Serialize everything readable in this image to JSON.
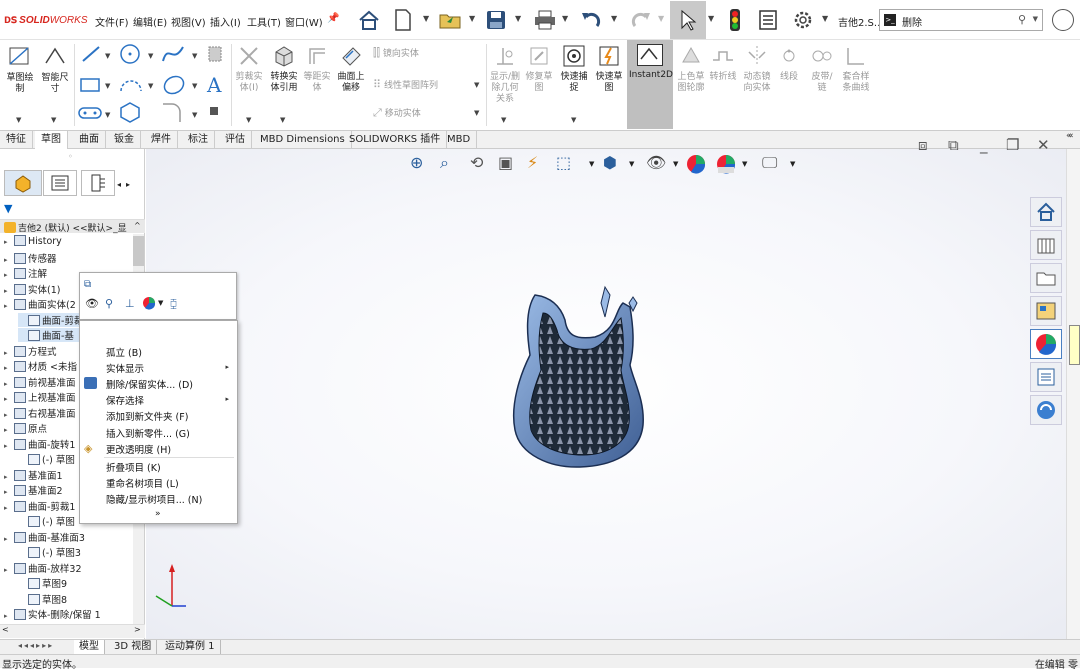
{
  "app": {
    "name_solid": "SOLID",
    "name_works": "WORKS",
    "doc_name": "吉他2.S..."
  },
  "menubar": [
    "文件(F)",
    "编辑(E)",
    "视图(V)",
    "插入(I)",
    "工具(T)",
    "窗口(W)"
  ],
  "search": {
    "value": "删除"
  },
  "ribbon": {
    "buttons": [
      {
        "id": "sketch",
        "label": "草图绘制",
        "disabled": false
      },
      {
        "id": "smartdim",
        "label": "智能尺寸",
        "disabled": false
      },
      {
        "id": "trim",
        "label": "剪裁实体(I)",
        "disabled": true
      },
      {
        "id": "convert",
        "label": "转换实体引用",
        "disabled": false
      },
      {
        "id": "offset",
        "label": "等距实体",
        "disabled": true
      },
      {
        "id": "offsetsurf",
        "label": "曲面上偏移",
        "disabled": false
      },
      {
        "id": "mirror",
        "label": "镜向实体",
        "disabled": true
      },
      {
        "id": "linpattern",
        "label": "线性草图阵列",
        "disabled": true
      },
      {
        "id": "move",
        "label": "移动实体",
        "disabled": true
      },
      {
        "id": "relations",
        "label": "显示/删除几何关系",
        "disabled": true
      },
      {
        "id": "repair",
        "label": "修复草图",
        "disabled": true
      },
      {
        "id": "snap",
        "label": "快速捕捉",
        "disabled": false
      },
      {
        "id": "rapid",
        "label": "快速草图",
        "disabled": false
      },
      {
        "id": "instant2d",
        "label": "Instant2D",
        "disabled": false
      },
      {
        "id": "shaded",
        "label": "上色草图轮廓",
        "disabled": true
      },
      {
        "id": "jog",
        "label": "转折线",
        "disabled": true
      },
      {
        "id": "dynmirror",
        "label": "动态镜向实体",
        "disabled": true
      },
      {
        "id": "segment",
        "label": "线段",
        "disabled": true
      },
      {
        "id": "chain",
        "label": "皮带/链",
        "disabled": true
      },
      {
        "id": "spline",
        "label": "套合样条曲线",
        "disabled": true
      }
    ]
  },
  "tabs": [
    "特征",
    "草图",
    "曲面",
    "钣金",
    "焊件",
    "标注",
    "评估",
    "MBD Dimensions",
    "SOLIDWORKS 插件",
    "MBD"
  ],
  "active_tab": "草图",
  "tree": {
    "root": "吉他2 (默认) <<默认>_显",
    "items": [
      {
        "label": "History",
        "indent": 0
      },
      {
        "label": "传感器",
        "indent": 0
      },
      {
        "label": "注解",
        "indent": 0
      },
      {
        "label": "实体(1)",
        "indent": 0
      },
      {
        "label": "曲面实体(2",
        "indent": 0
      },
      {
        "label": "曲面-剪裁1",
        "indent": 1
      },
      {
        "label": "曲面-基",
        "indent": 1
      },
      {
        "label": "方程式",
        "indent": 0
      },
      {
        "label": "材质 <未指",
        "indent": 0
      },
      {
        "label": "前视基准面",
        "indent": 0
      },
      {
        "label": "上视基准面",
        "indent": 0
      },
      {
        "label": "右视基准面",
        "indent": 0
      },
      {
        "label": "原点",
        "indent": 0
      },
      {
        "label": "曲面-旋转1",
        "indent": 0
      },
      {
        "label": "(-) 草图",
        "indent": 1
      },
      {
        "label": "基准面1",
        "indent": 0
      },
      {
        "label": "基准面2",
        "indent": 0
      },
      {
        "label": "曲面-剪裁1",
        "indent": 0
      },
      {
        "label": "(-) 草图",
        "indent": 1
      },
      {
        "label": "曲面-基准面3",
        "indent": 0
      },
      {
        "label": "(-) 草图3",
        "indent": 1
      },
      {
        "label": "曲面-放样32",
        "indent": 0
      },
      {
        "label": "草图9",
        "indent": 1
      },
      {
        "label": "草图8",
        "indent": 1
      },
      {
        "label": "实体-删除/保留 1",
        "indent": 0
      }
    ]
  },
  "context_menu": {
    "tooltip": "显示",
    "items": [
      {
        "label": "孤立 (B)",
        "submenu": false
      },
      {
        "label": "实体显示",
        "submenu": true
      },
      {
        "label": "删除/保留实体... (D)",
        "submenu": false
      },
      {
        "label": "保存选择",
        "submenu": true
      },
      {
        "label": "添加到新文件夹 (F)",
        "submenu": false
      },
      {
        "label": "插入到新零件... (G)",
        "submenu": false
      },
      {
        "label": "更改透明度 (H)",
        "submenu": false
      },
      {
        "label": "折叠项目 (K)",
        "submenu": false
      },
      {
        "label": "重命名树项目 (L)",
        "submenu": false
      },
      {
        "label": "隐藏/显示树项目... (N)",
        "submenu": false
      }
    ],
    "more": "»"
  },
  "bottom_tabs": [
    "模型",
    "3D 视图",
    "运动算例 1"
  ],
  "status": {
    "left": "显示选定的实体。",
    "right": "在编辑 零"
  },
  "colors": {
    "accent": "#0a63c9",
    "brand_red": "#d7261e",
    "selection": "#d6e6f7"
  }
}
